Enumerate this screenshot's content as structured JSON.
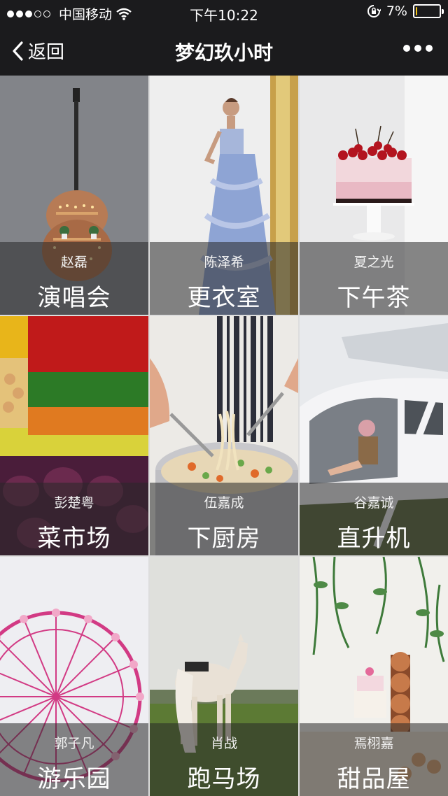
{
  "status_bar": {
    "carrier": "中国移动",
    "time": "下午10:22",
    "battery_percent": "7%",
    "battery_level": 0.07,
    "signal_bars_filled": 3,
    "signal_bars_total": 5,
    "icons": [
      "wifi-icon",
      "rotation-lock-icon",
      "battery-icon"
    ]
  },
  "nav": {
    "back_label": "返回",
    "title": "梦幻玖小时",
    "more_icon": "more-dots-icon"
  },
  "tiles": [
    {
      "name": "赵磊",
      "title": "演唱会"
    },
    {
      "name": "陈泽希",
      "title": "更衣室"
    },
    {
      "name": "夏之光",
      "title": "下午茶"
    },
    {
      "name": "彭楚粤",
      "title": "菜市场"
    },
    {
      "name": "伍嘉成",
      "title": "下厨房"
    },
    {
      "name": "谷嘉诚",
      "title": "直升机"
    },
    {
      "name": "郭子凡",
      "title": "游乐园"
    },
    {
      "name": "肖战",
      "title": "跑马场"
    },
    {
      "name": "焉栩嘉",
      "title": "甜品屋"
    }
  ],
  "colors": {
    "bar_background": "#1b1b1d",
    "battery_low": "#f5c518",
    "caption_overlay": "rgba(40,40,40,0.55)"
  }
}
